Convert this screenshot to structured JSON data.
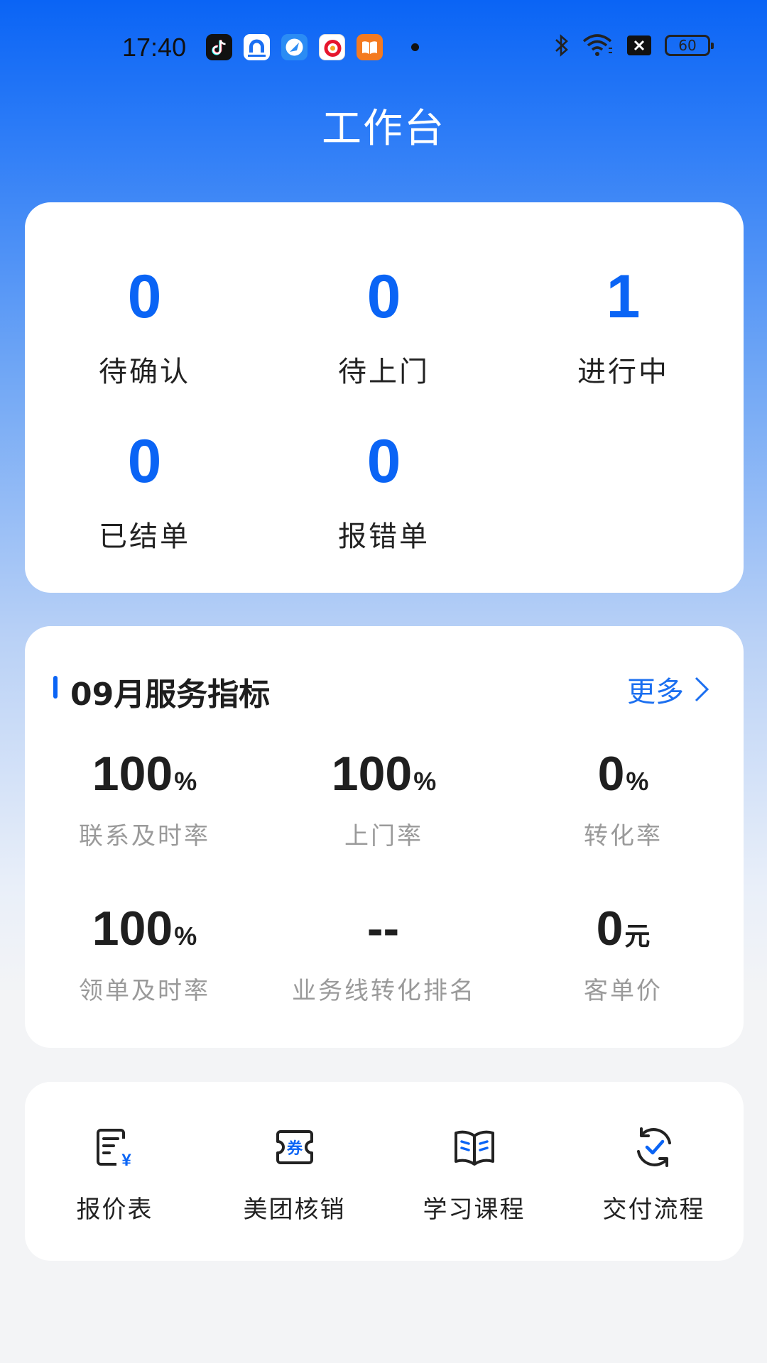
{
  "status_bar": {
    "time": "17:40",
    "battery": "60",
    "icons": [
      "tiktok-icon",
      "app2-icon",
      "app3-icon",
      "weibo-icon",
      "books-icon",
      "bluetooth-icon",
      "wifi-icon",
      "sim-icon",
      "battery-icon"
    ]
  },
  "header": {
    "title": "工作台"
  },
  "orders": [
    {
      "value": "0",
      "label": "待确认"
    },
    {
      "value": "0",
      "label": "待上门"
    },
    {
      "value": "1",
      "label": "进行中"
    },
    {
      "value": "0",
      "label": "已结单"
    },
    {
      "value": "0",
      "label": "报错单"
    }
  ],
  "metrics": {
    "title": "09月服务指标",
    "more_label": "更多",
    "items": [
      {
        "value": "100",
        "unit": "%",
        "label": "联系及时率"
      },
      {
        "value": "100",
        "unit": "%",
        "label": "上门率"
      },
      {
        "value": "0",
        "unit": "%",
        "label": "转化率"
      },
      {
        "value": "100",
        "unit": "%",
        "label": "领单及时率"
      },
      {
        "value": "--",
        "unit": "",
        "label": "业务线转化排名"
      },
      {
        "value": "0",
        "unit": "元",
        "label": "客单价"
      }
    ]
  },
  "tools": [
    {
      "label": "报价表",
      "icon": "price-list-icon",
      "badge": "¥"
    },
    {
      "label": "美团核销",
      "icon": "coupon-icon",
      "badge": "券"
    },
    {
      "label": "学习课程",
      "icon": "book-icon"
    },
    {
      "label": "交付流程",
      "icon": "process-check-icon"
    }
  ],
  "colors": {
    "primary": "#0a64f5",
    "text": "#222222",
    "muted": "#9a9a9a"
  }
}
